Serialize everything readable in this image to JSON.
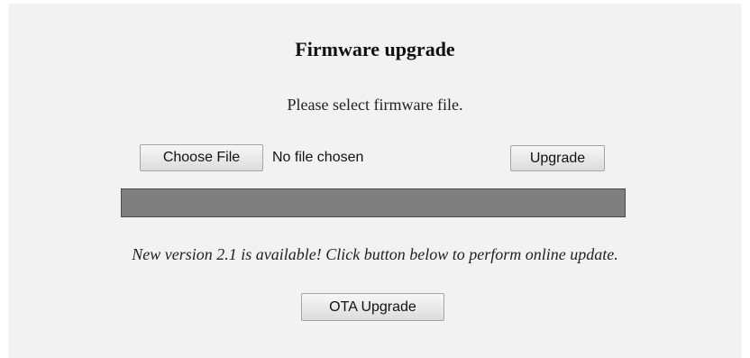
{
  "page": {
    "title": "Firmware upgrade",
    "prompt": "Please select firmware file.",
    "notice": "New version 2.1 is available! Click button below to perform online update."
  },
  "file_input": {
    "button_label": "Choose File",
    "status": "No file chosen"
  },
  "actions": {
    "upgrade_label": "Upgrade",
    "ota_label": "OTA Upgrade"
  },
  "progress": {
    "value": 1.0,
    "color": "#7f7f7f"
  },
  "colors": {
    "panel_background": "#f2f2f2",
    "page_background": "#ffffff"
  }
}
